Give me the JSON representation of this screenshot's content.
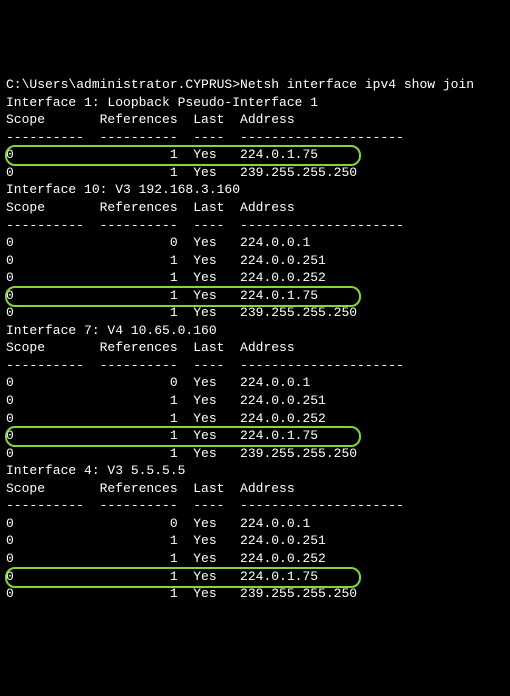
{
  "prompt": "C:\\Users\\administrator.CYPRUS>Netsh interface ipv4 show join",
  "headers": {
    "scope": "Scope",
    "references": "References",
    "last": "Last",
    "address": "Address"
  },
  "dashes": {
    "scope": "----------",
    "references": "----------",
    "last": "----",
    "address": "---------------------"
  },
  "interfaces": [
    {
      "title": "Interface 1: Loopback Pseudo-Interface 1",
      "rows": [
        {
          "scope": "0",
          "refs": "1",
          "last": "Yes",
          "addr": "224.0.1.75",
          "highlight": true
        },
        {
          "scope": "0",
          "refs": "1",
          "last": "Yes",
          "addr": "239.255.255.250",
          "highlight": false
        }
      ]
    },
    {
      "title": "Interface 10: V3 192.168.3.160",
      "rows": [
        {
          "scope": "0",
          "refs": "0",
          "last": "Yes",
          "addr": "224.0.0.1",
          "highlight": false
        },
        {
          "scope": "0",
          "refs": "1",
          "last": "Yes",
          "addr": "224.0.0.251",
          "highlight": false
        },
        {
          "scope": "0",
          "refs": "1",
          "last": "Yes",
          "addr": "224.0.0.252",
          "highlight": false
        },
        {
          "scope": "0",
          "refs": "1",
          "last": "Yes",
          "addr": "224.0.1.75",
          "highlight": true
        },
        {
          "scope": "0",
          "refs": "1",
          "last": "Yes",
          "addr": "239.255.255.250",
          "highlight": false
        }
      ]
    },
    {
      "title": "Interface 7: V4 10.65.0.160",
      "rows": [
        {
          "scope": "0",
          "refs": "0",
          "last": "Yes",
          "addr": "224.0.0.1",
          "highlight": false
        },
        {
          "scope": "0",
          "refs": "1",
          "last": "Yes",
          "addr": "224.0.0.251",
          "highlight": false
        },
        {
          "scope": "0",
          "refs": "1",
          "last": "Yes",
          "addr": "224.0.0.252",
          "highlight": false
        },
        {
          "scope": "0",
          "refs": "1",
          "last": "Yes",
          "addr": "224.0.1.75",
          "highlight": true
        },
        {
          "scope": "0",
          "refs": "1",
          "last": "Yes",
          "addr": "239.255.255.250",
          "highlight": false
        }
      ]
    },
    {
      "title": "Interface 4: V3 5.5.5.5",
      "rows": [
        {
          "scope": "0",
          "refs": "0",
          "last": "Yes",
          "addr": "224.0.0.1",
          "highlight": false
        },
        {
          "scope": "0",
          "refs": "1",
          "last": "Yes",
          "addr": "224.0.0.251",
          "highlight": false
        },
        {
          "scope": "0",
          "refs": "1",
          "last": "Yes",
          "addr": "224.0.0.252",
          "highlight": false
        },
        {
          "scope": "0",
          "refs": "1",
          "last": "Yes",
          "addr": "224.0.1.75",
          "highlight": true
        },
        {
          "scope": "0",
          "refs": "1",
          "last": "Yes",
          "addr": "239.255.255.250",
          "highlight": false
        }
      ]
    }
  ]
}
